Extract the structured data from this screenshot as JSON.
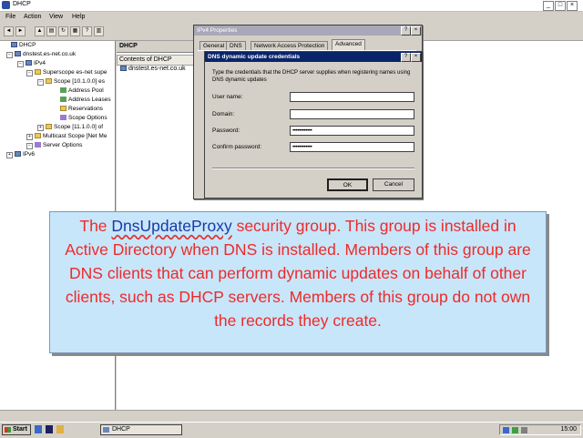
{
  "window": {
    "title": "DHCP",
    "controls": [
      "_",
      "□",
      "×"
    ]
  },
  "menu": [
    "File",
    "Action",
    "View",
    "Help"
  ],
  "tree": [
    {
      "label": "DHCP",
      "level": 0,
      "icon": "server-icon"
    },
    {
      "label": "dnstest.es-net.co.uk",
      "level": 1,
      "icon": "server-icon"
    },
    {
      "label": "IPv4",
      "level": 2,
      "icon": "server-icon"
    },
    {
      "label": "Superscope es-net supe",
      "level": 3,
      "icon": "folder-icon"
    },
    {
      "label": "Scope [10.1.0.0] es",
      "level": 4,
      "icon": "folder-icon"
    },
    {
      "label": "Address Pool",
      "level": 5,
      "icon": "pool-icon"
    },
    {
      "label": "Address Leases",
      "level": 5,
      "icon": "pool-icon"
    },
    {
      "label": "Reservations",
      "level": 5,
      "icon": "folder-icon"
    },
    {
      "label": "Scope Options",
      "level": 5,
      "icon": "options-icon"
    },
    {
      "label": "Scope [11.1.0.0] of",
      "level": 4,
      "icon": "folder-icon"
    },
    {
      "label": "Multicast Scope [Net Me",
      "level": 3,
      "icon": "folder-icon"
    },
    {
      "label": "Server Options",
      "level": 3,
      "icon": "options-icon"
    },
    {
      "label": "IPv6",
      "level": 1,
      "icon": "server-icon"
    }
  ],
  "right_pane": {
    "header": "DHCP",
    "contents_header": "Contents of DHCP",
    "items": [
      "dnstest.es-net.co.uk"
    ]
  },
  "ipv4_dialog": {
    "title": "IPv4 Properties",
    "tabs": [
      "General",
      "DNS",
      "Network Access Protection",
      "Advanced"
    ]
  },
  "dns_dialog": {
    "title": "DNS dynamic update credentials",
    "description": "Type the credentials that the DHCP server supplies when registering names using DNS dynamic updates",
    "fields": [
      {
        "label": "User name:",
        "value": ""
      },
      {
        "label": "Domain:",
        "value": ""
      },
      {
        "label": "Password:",
        "value": "••••••••••••"
      },
      {
        "label": "Confirm password:",
        "value": "••••••••••••"
      }
    ],
    "ok_label": "OK",
    "cancel_label": "Cancel"
  },
  "callout": {
    "prefix": "The ",
    "highlight": "DnsUpdateProxy",
    "suffix": " security group. This group is installed in Active Directory when DNS is installed. Members of this group are DNS clients that can perform dynamic updates on behalf of other clients, such as DHCP servers. Members of this group do not own the records they create."
  },
  "taskbar": {
    "start_label": "Start",
    "task_label": "DHCP",
    "clock": "15:00"
  }
}
